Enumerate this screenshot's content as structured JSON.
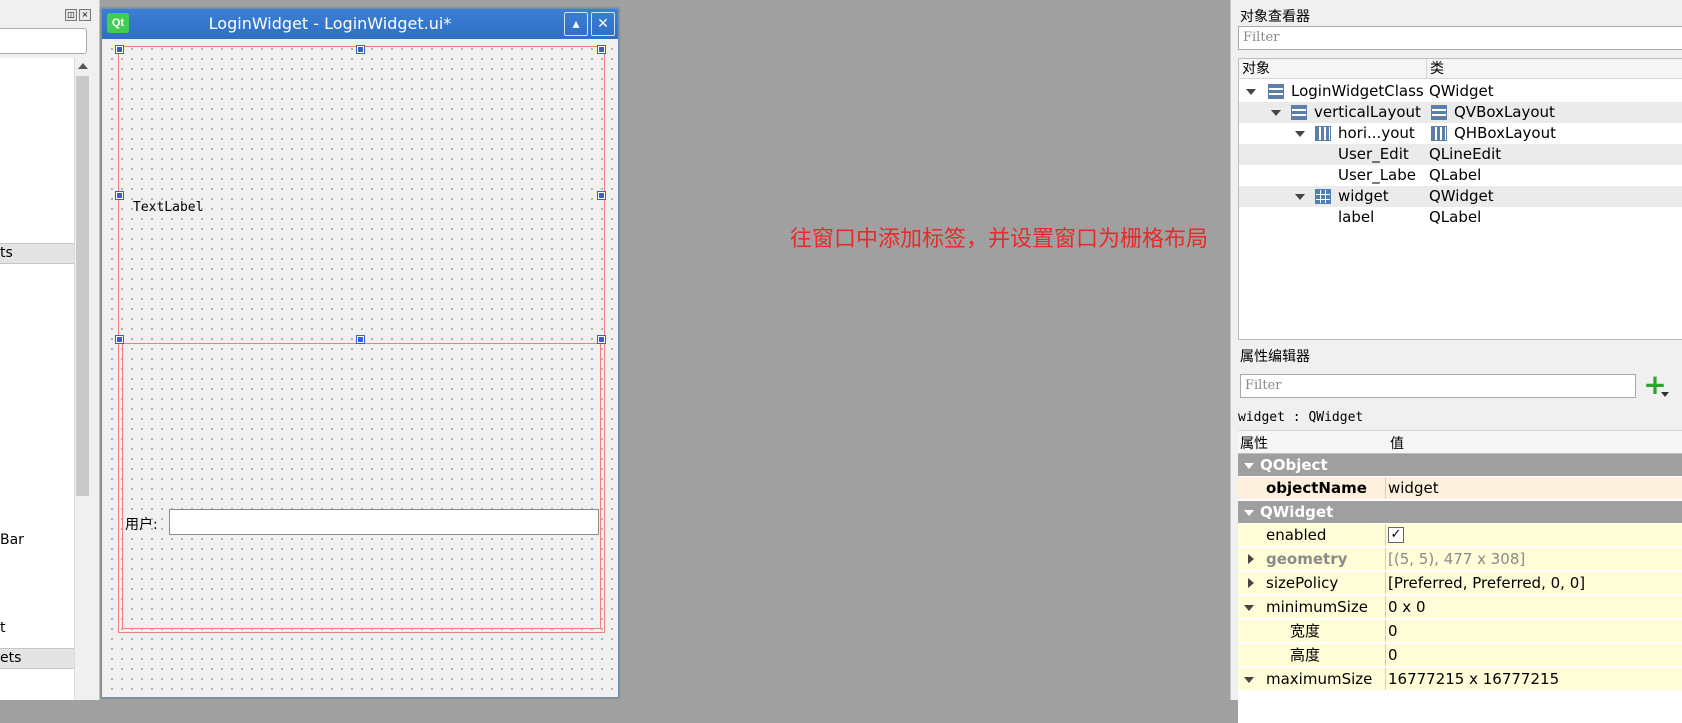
{
  "left_panel": {
    "categories": [
      "ts",
      "ets"
    ],
    "items": [
      "Bar",
      "t"
    ]
  },
  "form": {
    "logo": "Qt",
    "title": "LoginWidget - LoginWidget.ui*",
    "text_label": "TextLabel",
    "user_label": "用户:",
    "user_edit_value": ""
  },
  "annotation": "往窗口中添加标签，并设置窗口为栅格布局",
  "object_inspector": {
    "title": "对象查看器",
    "filter_placeholder": "Filter",
    "col_object": "对象",
    "col_class": "类",
    "rows": [
      {
        "object": "LoginWidgetClass",
        "class": "QWidget",
        "icon": "vbox-layout-icon"
      },
      {
        "object": "verticalLayout",
        "class": "QVBoxLayout",
        "icon": "vbox-layout-icon"
      },
      {
        "object": "hori...yout",
        "class": "QHBoxLayout",
        "icon": "hbox-layout-icon"
      },
      {
        "object": "User_Edit",
        "class": "QLineEdit",
        "icon": ""
      },
      {
        "object": "User_Labe",
        "class": "QLabel",
        "icon": ""
      },
      {
        "object": "widget",
        "class": "QWidget",
        "icon": "grid-layout-icon"
      },
      {
        "object": "label",
        "class": "QLabel",
        "icon": ""
      }
    ]
  },
  "property_editor": {
    "title": "属性编辑器",
    "filter_placeholder": "Filter",
    "context": "widget : QWidget",
    "col_property": "属性",
    "col_value": "值",
    "rows": [
      {
        "name": "QObject",
        "value": ""
      },
      {
        "name": "objectName",
        "value": "widget"
      },
      {
        "name": "QWidget",
        "value": ""
      },
      {
        "name": "enabled",
        "value": "✓"
      },
      {
        "name": "geometry",
        "value": "[(5, 5), 477 x 308]"
      },
      {
        "name": "sizePolicy",
        "value": "[Preferred, Preferred, 0, 0]"
      },
      {
        "name": "minimumSize",
        "value": "0 x 0"
      },
      {
        "name": "宽度",
        "value": "0"
      },
      {
        "name": "高度",
        "value": "0"
      },
      {
        "name": "maximumSize",
        "value": "16777215 x 16777215"
      }
    ]
  },
  "colors": {
    "annotation": "#e82a2a",
    "titlebar": "#2f6fc4",
    "group_header": "#9f9f9f",
    "property_highlight": "#fdf0dc",
    "property_row": "#fefdd8"
  }
}
